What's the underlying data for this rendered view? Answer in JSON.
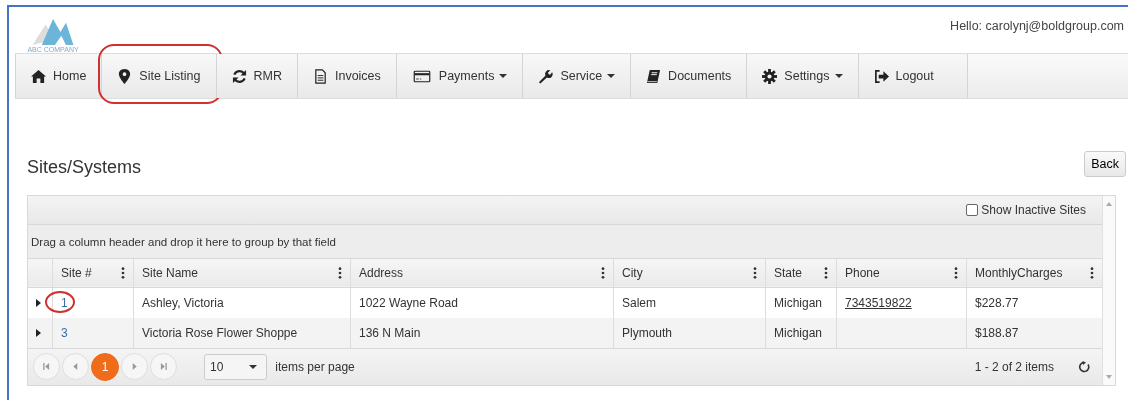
{
  "header": {
    "logo_text": "ABC COMPANY",
    "greeting": "Hello: carolynj@boldgroup.com"
  },
  "nav": [
    {
      "label": "Home",
      "dropdown": false,
      "circled": false
    },
    {
      "label": "Site Listing",
      "dropdown": false,
      "circled": true
    },
    {
      "label": "RMR",
      "dropdown": false,
      "circled": false
    },
    {
      "label": "Invoices",
      "dropdown": false,
      "circled": false
    },
    {
      "label": "Payments",
      "dropdown": true,
      "circled": false
    },
    {
      "label": "Service",
      "dropdown": true,
      "circled": false
    },
    {
      "label": "Documents",
      "dropdown": false,
      "circled": false
    },
    {
      "label": "Settings",
      "dropdown": true,
      "circled": false
    },
    {
      "label": "Logout",
      "dropdown": false,
      "circled": false
    }
  ],
  "page": {
    "title": "Sites/Systems",
    "back_button": "Back"
  },
  "grid": {
    "show_inactive": {
      "label": "Show Inactive Sites",
      "checked": false
    },
    "group_hint": "Drag a column header and drop it here to group by that field",
    "columns": [
      "Site #",
      "Site Name",
      "Address",
      "City",
      "State",
      "Phone",
      "MonthlyCharges"
    ],
    "rows": [
      {
        "circled": true,
        "cells": [
          "1",
          "Ashley, Victoria",
          "1022 Wayne Road",
          "Salem",
          "Michigan",
          "7343519822",
          "$228.77"
        ]
      },
      {
        "circled": false,
        "cells": [
          "3",
          "Victoria Rose Flower Shoppe",
          "136 N Main",
          "Plymouth",
          "Michigan",
          "",
          "$188.87"
        ]
      }
    ],
    "pager": {
      "pages": [
        {
          "label": "1",
          "selected": true
        }
      ],
      "page_size": "10",
      "page_size_label": "items per page",
      "summary": "1 - 2 of 2 items"
    }
  }
}
